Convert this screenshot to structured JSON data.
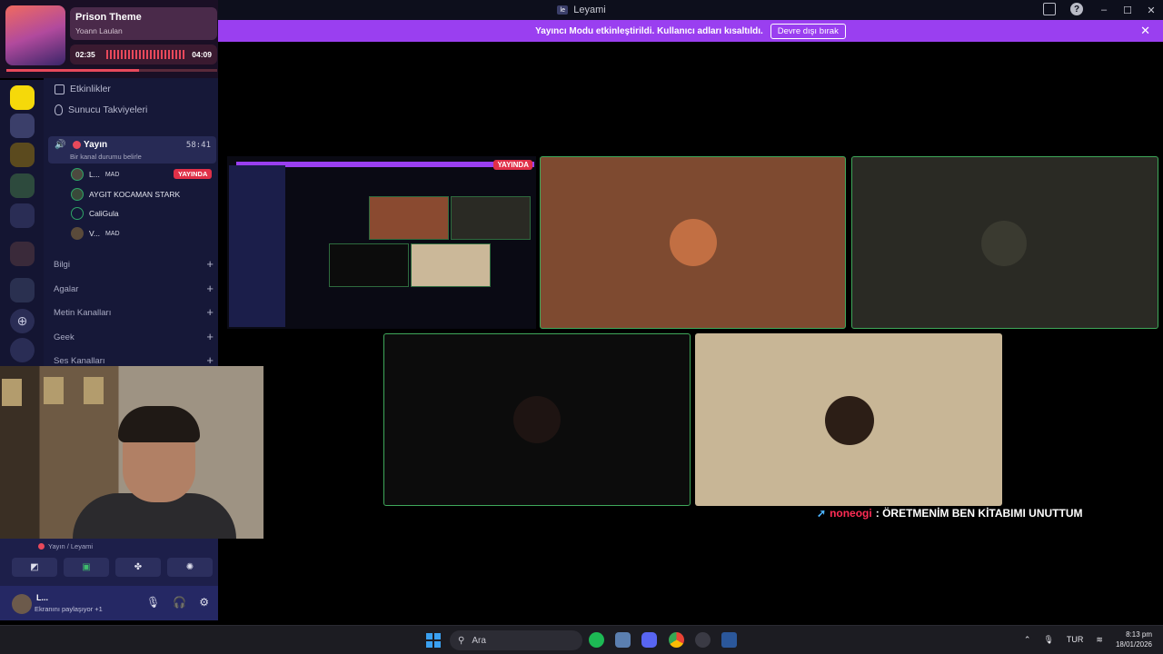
{
  "window": {
    "title": "Leyami",
    "app_icon": "leyami-icon"
  },
  "banner": {
    "message": "Yayıncı Modu etkinleştirildi. Kullanıcı adları kısaltıldı.",
    "button": "Devre dışı bırak"
  },
  "now_playing": {
    "title": "Prison Theme",
    "artist": "Yoann Laulan",
    "elapsed": "02:35",
    "total": "04:09",
    "progress": 0.63
  },
  "channels": {
    "top_items": [
      {
        "label": "Etkinlikler",
        "icon": "calendar-icon"
      },
      {
        "label": "Sunucu Takviyeleri",
        "icon": "boost-icon"
      }
    ],
    "voice_channel": {
      "name": "Yayın",
      "time": "58:41",
      "status": "Bir kanal durumu belirle"
    },
    "voice_users": [
      {
        "name": "L...",
        "tag": "MAD",
        "live": "YAYINDA"
      },
      {
        "name": "AYGIT KOCAMAN STARK",
        "tag": ""
      },
      {
        "name": "CaliGula",
        "tag": ""
      },
      {
        "name": "V...",
        "tag": "MAD"
      }
    ],
    "categories": [
      "Bilgi",
      "Agalar",
      "Metin Kanalları",
      "Geek",
      "Ses Kanalları"
    ]
  },
  "voice_panel": {
    "location": "Yayın / Leyami",
    "user": {
      "name": "L...",
      "status": "Ekranını paylaşıyor +1"
    }
  },
  "stream": {
    "badge": "YAYINDA"
  },
  "chat": {
    "user": "noneogi",
    "message": ": ÖRETMENİM BEN KİTABIMI UNUTTUM"
  },
  "taskbar": {
    "search_placeholder": "Ara",
    "language": "TUR",
    "time": "8:13 pm",
    "date": "18/01/2026"
  },
  "colors": {
    "accent": "#9a3ff0",
    "live": "#e03048",
    "speaking": "#3fa85a"
  }
}
